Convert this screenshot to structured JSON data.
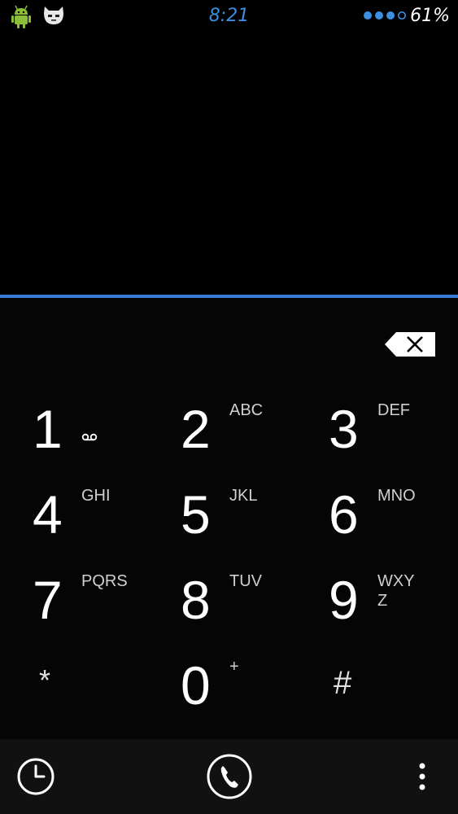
{
  "status_bar": {
    "time": "8:21",
    "battery": "61%",
    "left_icons": [
      "android-debug-icon",
      "cyanogenmod-icon"
    ],
    "right_icons": [
      "signal-dots-icon"
    ]
  },
  "dialer": {
    "digits": "",
    "keys": [
      {
        "digit": "1",
        "letters": "",
        "icon": "voicemail-icon"
      },
      {
        "digit": "2",
        "letters": "ABC"
      },
      {
        "digit": "3",
        "letters": "DEF"
      },
      {
        "digit": "4",
        "letters": "GHI"
      },
      {
        "digit": "5",
        "letters": "JKL"
      },
      {
        "digit": "6",
        "letters": "MNO"
      },
      {
        "digit": "7",
        "letters": "PQRS"
      },
      {
        "digit": "8",
        "letters": "TUV"
      },
      {
        "digit": "9",
        "letters": "WXY Z"
      },
      {
        "digit": "*",
        "letters": ""
      },
      {
        "digit": "0",
        "letters": "+"
      },
      {
        "digit": "#",
        "letters": ""
      }
    ],
    "backspace_icon": "backspace-icon"
  },
  "action_bar": {
    "icons": [
      "clock-history-icon",
      "phone-call-icon",
      "overflow-menu-icon"
    ]
  },
  "colors": {
    "accent": "#3a7bd5",
    "clock": "#3d8fe0",
    "background": "#000000",
    "action_bar": "#111111"
  }
}
